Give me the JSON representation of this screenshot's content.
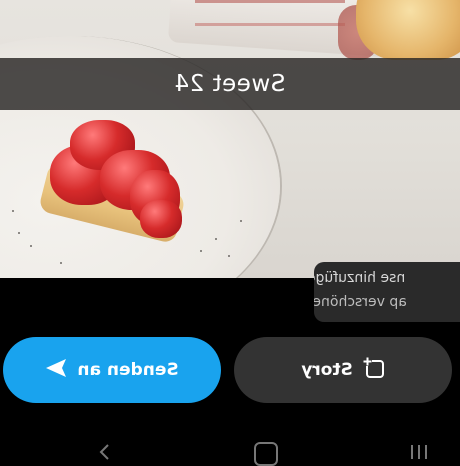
{
  "photo": {
    "caption": "Sweet 24",
    "subject": "strawberry-cake-on-plate"
  },
  "options": {
    "item1": "nse hinzufügen",
    "item2": "ap verschönern"
  },
  "buttons": {
    "story": {
      "label": "Story",
      "icon": "add-story-icon"
    },
    "send": {
      "label": "Senden an",
      "icon": "send-arrow-icon"
    }
  },
  "navbar": {
    "back_icon": "back-chevron-icon",
    "home_icon": "home-icon",
    "recents_icon": "recents-icon"
  },
  "colors": {
    "send_button": "#19a3ee",
    "story_button": "#333333",
    "background": "#000000"
  }
}
